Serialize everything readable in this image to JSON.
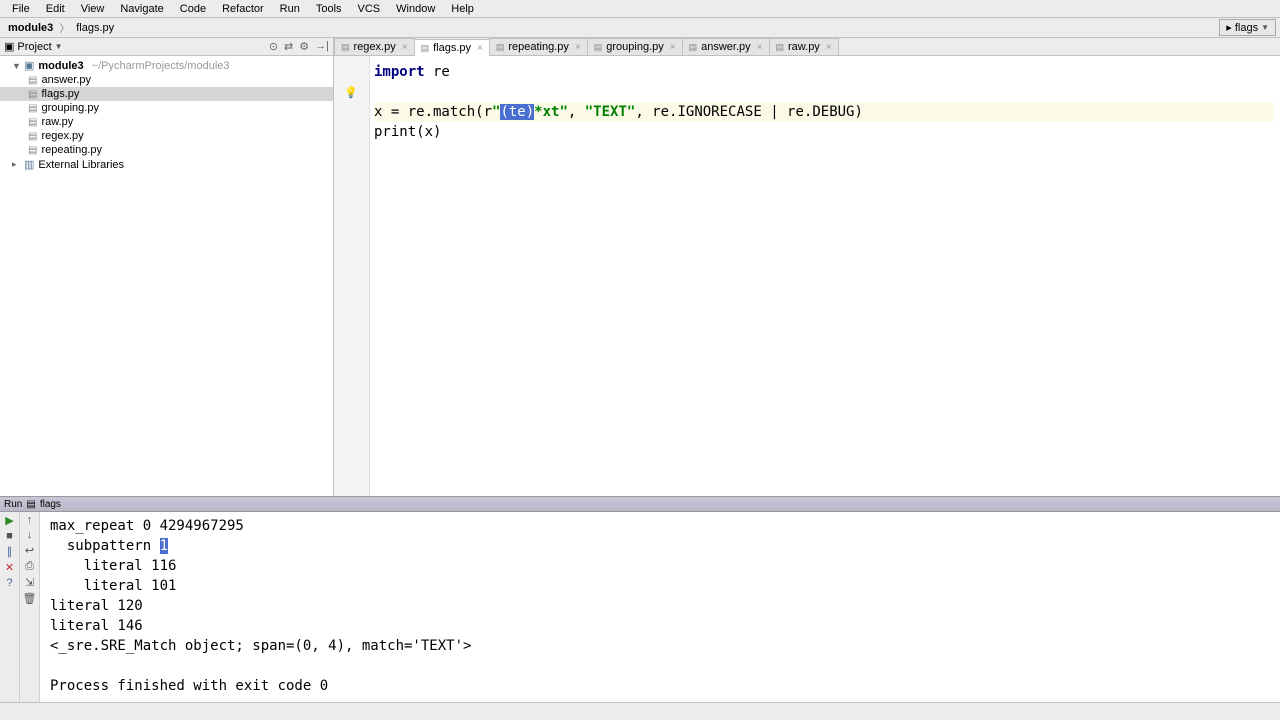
{
  "menu": [
    "File",
    "Edit",
    "View",
    "Navigate",
    "Code",
    "Refactor",
    "Run",
    "Tools",
    "VCS",
    "Window",
    "Help"
  ],
  "breadcrumb": {
    "root": "module3",
    "file": "flags.py"
  },
  "top_right_button": "flags",
  "project_panel": {
    "title": "Project",
    "root": {
      "name": "module3",
      "path": "~/PycharmProjects/module3"
    },
    "files": [
      "answer.py",
      "flags.py",
      "grouping.py",
      "raw.py",
      "regex.py",
      "repeating.py"
    ],
    "active_file": "flags.py",
    "ext_lib": "External Libraries"
  },
  "tabs": [
    {
      "label": "regex.py",
      "active": false
    },
    {
      "label": "flags.py",
      "active": true
    },
    {
      "label": "repeating.py",
      "active": false
    },
    {
      "label": "grouping.py",
      "active": false
    },
    {
      "label": "answer.py",
      "active": false
    },
    {
      "label": "raw.py",
      "active": false
    }
  ],
  "code": {
    "kw_import": "import",
    "mod_re": " re",
    "l3_pre": "x = re.match(r",
    "l3_q1": "\"",
    "l3_sel": "(te)",
    "l3_post_in_str": "*xt\"",
    "l3_mid": ", ",
    "l3_str2": "\"TEXT\"",
    "l3_rest": ", re.IGNORECASE | re.DEBUG)",
    "l4": "print(x)"
  },
  "run": {
    "tab_label_left": "Run",
    "tab_label": "flags",
    "lines": [
      "max_repeat 0 4294967295",
      "  subpattern ",
      "1",
      "    literal 116",
      "    literal 101",
      "literal 120",
      "literal 146",
      "<_sre.SRE_Match object; span=(0, 4), match='TEXT'>",
      "",
      "Process finished with exit code 0"
    ]
  }
}
